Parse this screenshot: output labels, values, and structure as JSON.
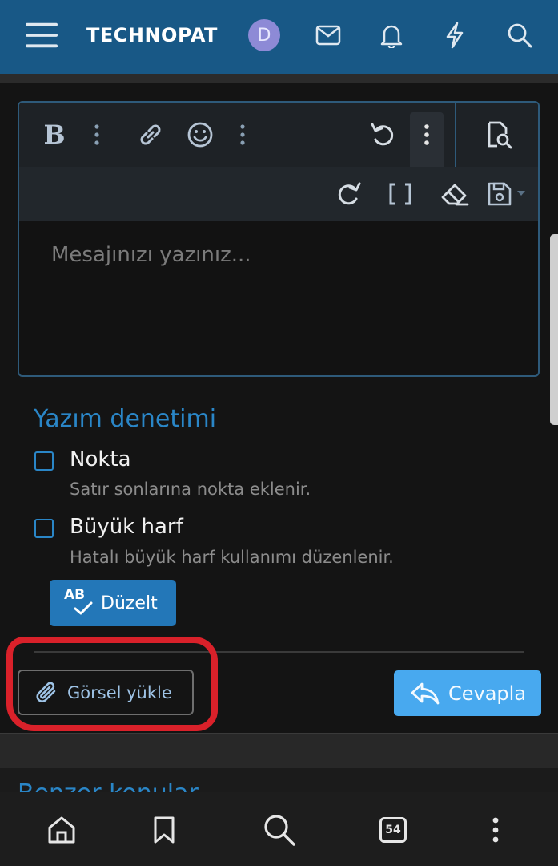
{
  "header": {
    "brand": "TECHNOPAT",
    "avatar_letter": "D",
    "icons": [
      "menu-icon",
      "mail-icon",
      "bell-icon",
      "lightning-icon",
      "search-icon"
    ],
    "color": "#185886"
  },
  "editor": {
    "placeholder": "Mesajınızı yazınız...",
    "toolbar_row1": [
      "bold",
      "more-vertical",
      "link",
      "emoji",
      "more-vertical",
      "undo",
      "more-vertical",
      "preview"
    ],
    "toolbar_row2": [
      "redo",
      "brackets",
      "eraser",
      "save-draft"
    ],
    "bold_label": "B"
  },
  "spellcheck": {
    "title": "Yazım denetimi",
    "options": [
      {
        "label": "Nokta",
        "description": "Satır sonlarına nokta eklenir.",
        "checked": false
      },
      {
        "label": "Büyük harf",
        "description": "Hatalı büyük harf kullanımı düzenlenir.",
        "checked": false
      }
    ],
    "fix_button": "Düzelt",
    "fix_icon_text": "AB"
  },
  "actions": {
    "upload_label": "Görsel yükle",
    "reply_label": "Cevapla",
    "reply_color": "#48a9ef",
    "annotation_color": "#d9212a"
  },
  "lower": {
    "cut_text": "Benzer konular"
  },
  "bottom_nav": {
    "items": [
      "home-icon",
      "bookmark-icon",
      "search-icon",
      "tabs-icon",
      "more-icon"
    ],
    "tabs_count": "54"
  }
}
